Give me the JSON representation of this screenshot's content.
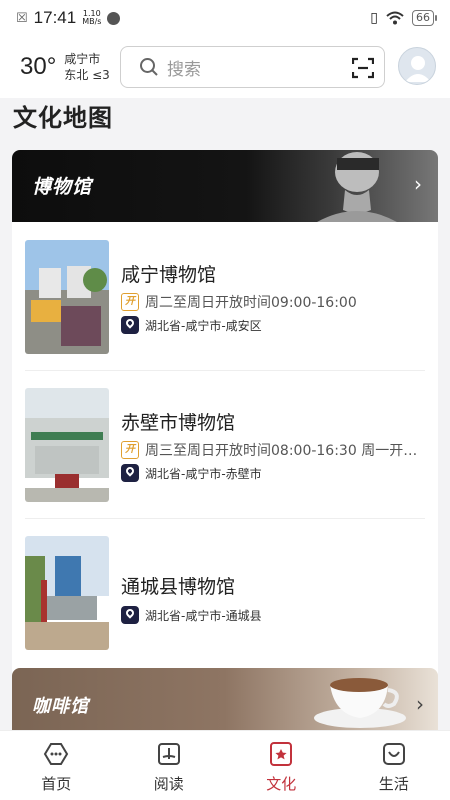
{
  "status_bar": {
    "time": "17:41",
    "net_speed_value": "1.10",
    "net_speed_unit": "MB/s",
    "battery": "66"
  },
  "header": {
    "temperature": "30°",
    "city": "咸宁市",
    "wind": "东北 ≤3",
    "search_placeholder": "搜索"
  },
  "page_title": "文化地图",
  "museums": {
    "banner_title": "博物馆",
    "items": [
      {
        "name": "咸宁博物馆",
        "hours": "周二至周日开放时间09:00-16:00",
        "location": "湖北省-咸宁市-咸安区"
      },
      {
        "name": "赤壁市博物馆",
        "hours": "周三至周日开放时间08:00-16:30 周一开…",
        "location": "湖北省-咸宁市-赤壁市"
      },
      {
        "name": "通城县博物馆",
        "hours": "",
        "location": "湖北省-咸宁市-通城县"
      }
    ],
    "open_badge": "开"
  },
  "cafe": {
    "banner_title": "咖啡馆"
  },
  "nav": {
    "tabs": [
      {
        "label": "首页",
        "icon": "home-icon"
      },
      {
        "label": "阅读",
        "icon": "book-icon"
      },
      {
        "label": "文化",
        "icon": "culture-icon",
        "active": true
      },
      {
        "label": "生活",
        "icon": "life-icon"
      }
    ]
  },
  "colors": {
    "accent": "#c2323c",
    "pin_bg": "#1e2142",
    "open_badge": "#e0a030"
  }
}
